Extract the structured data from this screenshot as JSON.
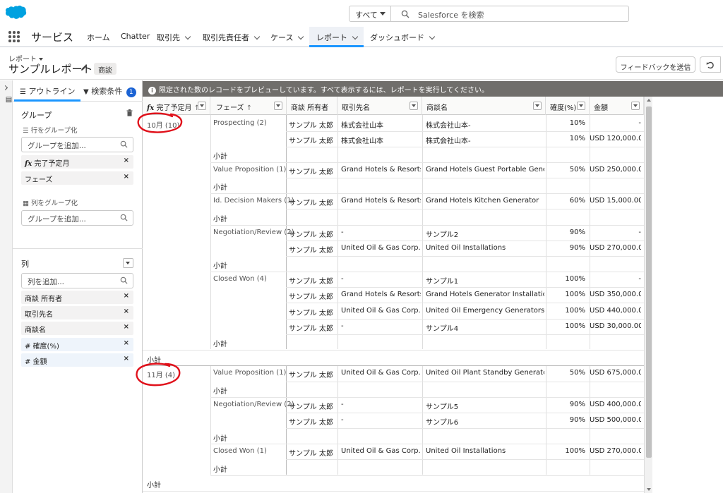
{
  "header": {
    "search_scope": "すべて",
    "search_placeholder": "Salesforce を検索"
  },
  "nav": {
    "app_name": "サービス",
    "items": [
      "ホーム",
      "Chatter",
      "取引先",
      "取引先責任者",
      "ケース",
      "レポート",
      "ダッシュボード"
    ],
    "active": "レポート"
  },
  "page": {
    "breadcrumb": "レポート",
    "title": "サンプルレポート",
    "object_badge": "商談",
    "feedback_button": "フィードバックを送信"
  },
  "panel": {
    "tab_outline": "アウトライン",
    "tab_filters": "検索条件",
    "filter_count": "1",
    "groups_title": "グループ",
    "row_group_label": "行をグループ化",
    "add_group_placeholder": "グループを追加...",
    "row_groups": [
      "完了予定月",
      "フェーズ"
    ],
    "col_group_label": "列をグループ化",
    "columns_title": "列",
    "add_column_placeholder": "列を追加...",
    "columns": [
      "商談 所有者",
      "取引先名",
      "商談名",
      "# 確度(%)",
      "# 金額"
    ]
  },
  "preview_message": "限定された数のレコードをプレビューしています。すべて表示するには、レポートを実行してください。",
  "table": {
    "headers": [
      "完了予定月",
      "フェーズ",
      "商談 所有者",
      "取引先名",
      "商談名",
      "確度(%)",
      "金額"
    ],
    "subtotal_label": "小計",
    "group_oct": "10月 (10)",
    "group_nov": "11月 (4)",
    "phases": {
      "prospecting": "Prospecting (2)",
      "value_prop_oct": "Value Proposition (1)",
      "id_decision": "Id. Decision Makers (1)",
      "negotiation_oct": "Negotiation/Review (2)",
      "closed_won_oct": "Closed Won (4)",
      "value_prop_nov": "Value Proposition (1)",
      "negotiation_nov": "Negotiation/Review (2)",
      "closed_won_nov": "Closed Won (1)"
    },
    "rows": [
      {
        "owner": "サンプル 太郎",
        "account": "株式会社山本",
        "opp": "株式会社山本-",
        "prob": "10%",
        "amount": "-"
      },
      {
        "owner": "サンプル 太郎",
        "account": "株式会社山本",
        "opp": "株式会社山本-",
        "prob": "10%",
        "amount": "USD 120,000.00"
      },
      {
        "owner": "サンプル 太郎",
        "account": "Grand Hotels & Resorts Ltd",
        "opp": "Grand Hotels Guest Portable Generators",
        "prob": "50%",
        "amount": "USD 250,000.00"
      },
      {
        "owner": "サンプル 太郎",
        "account": "Grand Hotels & Resorts Ltd",
        "opp": "Grand Hotels Kitchen Generator",
        "prob": "60%",
        "amount": "USD 15,000.00"
      },
      {
        "owner": "サンプル 太郎",
        "account": "-",
        "opp": "サンプル2",
        "prob": "90%",
        "amount": "-"
      },
      {
        "owner": "サンプル 太郎",
        "account": "United Oil & Gas Corp.",
        "opp": "United Oil Installations",
        "prob": "90%",
        "amount": "USD 270,000.00"
      },
      {
        "owner": "サンプル 太郎",
        "account": "-",
        "opp": "サンプル1",
        "prob": "100%",
        "amount": "-"
      },
      {
        "owner": "サンプル 太郎",
        "account": "Grand Hotels & Resorts Ltd",
        "opp": "Grand Hotels Generator Installations",
        "prob": "100%",
        "amount": "USD 350,000.00"
      },
      {
        "owner": "サンプル 太郎",
        "account": "United Oil & Gas Corp.",
        "opp": "United Oil Emergency Generators",
        "prob": "100%",
        "amount": "USD 440,000.00"
      },
      {
        "owner": "サンプル 太郎",
        "account": "-",
        "opp": "サンプル4",
        "prob": "100%",
        "amount": "USD 30,000.00"
      },
      {
        "owner": "サンプル 太郎",
        "account": "United Oil & Gas Corp.",
        "opp": "United Oil Plant Standby Generators",
        "prob": "50%",
        "amount": "USD 675,000.00"
      },
      {
        "owner": "サンプル 太郎",
        "account": "-",
        "opp": "サンプル5",
        "prob": "90%",
        "amount": "USD 400,000.00"
      },
      {
        "owner": "サンプル 太郎",
        "account": "-",
        "opp": "サンプル6",
        "prob": "90%",
        "amount": "USD 500,000.00"
      },
      {
        "owner": "サンプル 太郎",
        "account": "United Oil & Gas Corp.",
        "opp": "United Oil Installations",
        "prob": "100%",
        "amount": "USD 270,000.00"
      }
    ]
  },
  "colors": {
    "brand": "#00a1e0",
    "accent": "#1b96ff",
    "annotation": "#e0101a"
  }
}
